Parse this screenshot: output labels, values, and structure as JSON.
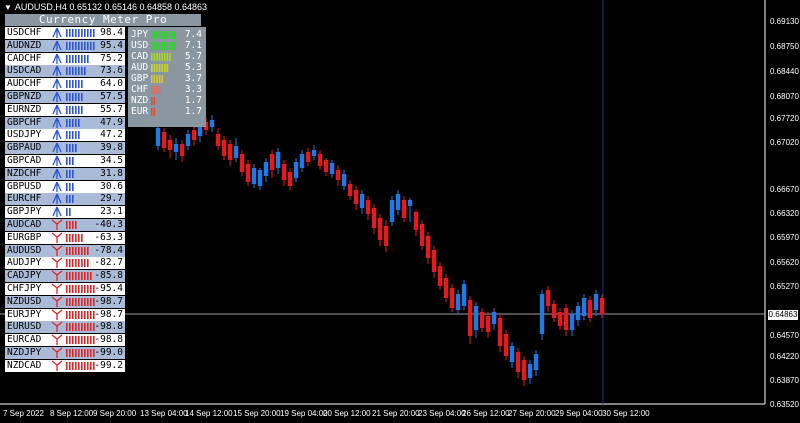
{
  "header": {
    "title": "AUDUSD,H4  0.65132 0.65146 0.64858 0.64863"
  },
  "meter": {
    "title": "Currency Meter Pro",
    "pairs": [
      {
        "name": "USDCHF",
        "value": "98.4",
        "dir": "up"
      },
      {
        "name": "AUDNZD",
        "value": "95.4",
        "dir": "up"
      },
      {
        "name": "CADCHF",
        "value": "75.2",
        "dir": "up"
      },
      {
        "name": "USDCAD",
        "value": "73.6",
        "dir": "up"
      },
      {
        "name": "AUDCHF",
        "value": "64.0",
        "dir": "up"
      },
      {
        "name": "GBPNZD",
        "value": "57.5",
        "dir": "up"
      },
      {
        "name": "EURNZD",
        "value": "55.7",
        "dir": "up"
      },
      {
        "name": "GBPCHF",
        "value": "47.9",
        "dir": "up"
      },
      {
        "name": "USDJPY",
        "value": "47.2",
        "dir": "up"
      },
      {
        "name": "GBPAUD",
        "value": "39.8",
        "dir": "up"
      },
      {
        "name": "GBPCAD",
        "value": "34.5",
        "dir": "up"
      },
      {
        "name": "NZDCHF",
        "value": "31.8",
        "dir": "up"
      },
      {
        "name": "GBPUSD",
        "value": "30.6",
        "dir": "up"
      },
      {
        "name": "EURCHF",
        "value": "29.7",
        "dir": "up"
      },
      {
        "name": "GBPJPY",
        "value": "23.1",
        "dir": "up"
      },
      {
        "name": "AUDCAD",
        "value": "-40.3",
        "dir": "down"
      },
      {
        "name": "EURGBP",
        "value": "-63.3",
        "dir": "down"
      },
      {
        "name": "AUDUSD",
        "value": "-78.4",
        "dir": "down"
      },
      {
        "name": "AUDJPY",
        "value": "-82.7",
        "dir": "down"
      },
      {
        "name": "CADJPY",
        "value": "-85.8",
        "dir": "down"
      },
      {
        "name": "CHFJPY",
        "value": "-95.4",
        "dir": "down"
      },
      {
        "name": "NZDUSD",
        "value": "-98.7",
        "dir": "down"
      },
      {
        "name": "EURJPY",
        "value": "-98.7",
        "dir": "down"
      },
      {
        "name": "EURUSD",
        "value": "-98.8",
        "dir": "down"
      },
      {
        "name": "EURCAD",
        "value": "-98.8",
        "dir": "down"
      },
      {
        "name": "NZDJPY",
        "value": "-99.0",
        "dir": "down"
      },
      {
        "name": "NZDCAD",
        "value": "-99.2",
        "dir": "down"
      }
    ],
    "currencies": [
      {
        "name": "JPY",
        "value": "7.4",
        "color": "#2ed42e"
      },
      {
        "name": "USD",
        "value": "7.1",
        "color": "#2ed42e"
      },
      {
        "name": "CAD",
        "value": "5.7",
        "color": "#a8d42e"
      },
      {
        "name": "AUD",
        "value": "5.3",
        "color": "#c8d42e"
      },
      {
        "name": "GBP",
        "value": "3.7",
        "color": "#d4c82e"
      },
      {
        "name": "CHF",
        "value": "3.3",
        "color": "#e86a5a"
      },
      {
        "name": "NZD",
        "value": "1.7",
        "color": "#e84a3a"
      },
      {
        "name": "EUR",
        "value": "1.7",
        "color": "#e84a3a"
      }
    ]
  },
  "axis": {
    "prices": [
      "0.69130",
      "0.68750",
      "0.68440",
      "0.68070",
      "0.67720",
      "0.67020",
      "0.66670",
      "0.66320",
      "0.65970",
      "0.65620",
      "0.65270",
      "0.64570",
      "0.64220",
      "0.63870",
      "0.63520"
    ],
    "current_price": "0.64863",
    "times": [
      "7 Sep 2022",
      "8 Sep 12:00",
      "9 Sep 20:00",
      "13 Sep 04:00",
      "14 Sep 12:00",
      "15 Sep 20:00",
      "19 Sep 04:00",
      "20 Sep 12:00",
      "21 Sep 20:00",
      "23 Sep 04:00",
      "26 Sep 12:00",
      "27 Sep 20:00",
      "29 Sep 04:00",
      "30 Sep 12:00"
    ]
  },
  "colors": {
    "bull": "#1e7be6",
    "bear": "#e6191e",
    "up_pair_bg": "#aabbd8",
    "up_pair_bg_alt": "#ffffff",
    "down_pair_bg": "#aabbd8"
  }
}
